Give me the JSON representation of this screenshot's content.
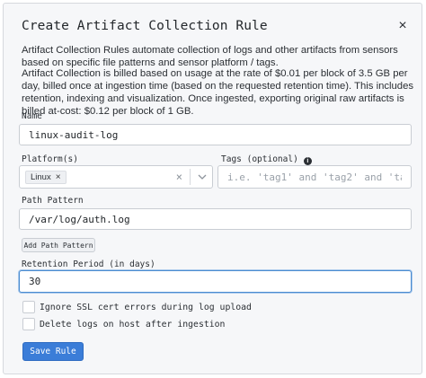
{
  "dialog": {
    "title": "Create Artifact Collection Rule",
    "close_glyph": "×",
    "description_1": "Artifact Collection Rules automate collection of logs and other artifacts from sensors based on specific file patterns and sensor platform / tags.",
    "description_2": "Artifact Collection is billed based on usage at the rate of $0.01 per block of 3.5 GB per day, billed once at ingestion time (based on the requested retention time). This includes retention, indexing and visualization. Once ingested, exporting original raw artifacts is billed at-cost: $0.12 per block of 1 GB."
  },
  "form": {
    "name": {
      "label": "Name",
      "value": "linux-audit-log"
    },
    "platforms": {
      "label": "Platform(s)",
      "selected": [
        "Linux"
      ],
      "chip_remove_glyph": "×",
      "clear_glyph": "×"
    },
    "tags": {
      "label": "Tags (optional)",
      "info_glyph": "i",
      "placeholder": "i.e. 'tag1' and 'tag2' and 'tag3'"
    },
    "path_pattern": {
      "label": "Path Pattern",
      "value": "/var/log/auth.log"
    },
    "add_path_button": "Add Path Pattern",
    "retention": {
      "label": "Retention Period (in days)",
      "value": "30"
    },
    "checkboxes": [
      {
        "label": "Ignore SSL cert errors during log upload",
        "checked": false
      },
      {
        "label": "Delete logs on host after ingestion",
        "checked": false
      }
    ],
    "submit_button": "Save Rule"
  },
  "colors": {
    "primary": "#3b7dd8",
    "focus_border": "#4a8bd0",
    "background": "#f6f7f9"
  },
  "icons": [
    "close-icon",
    "clear-icon",
    "chevron-down-icon",
    "info-icon"
  ]
}
